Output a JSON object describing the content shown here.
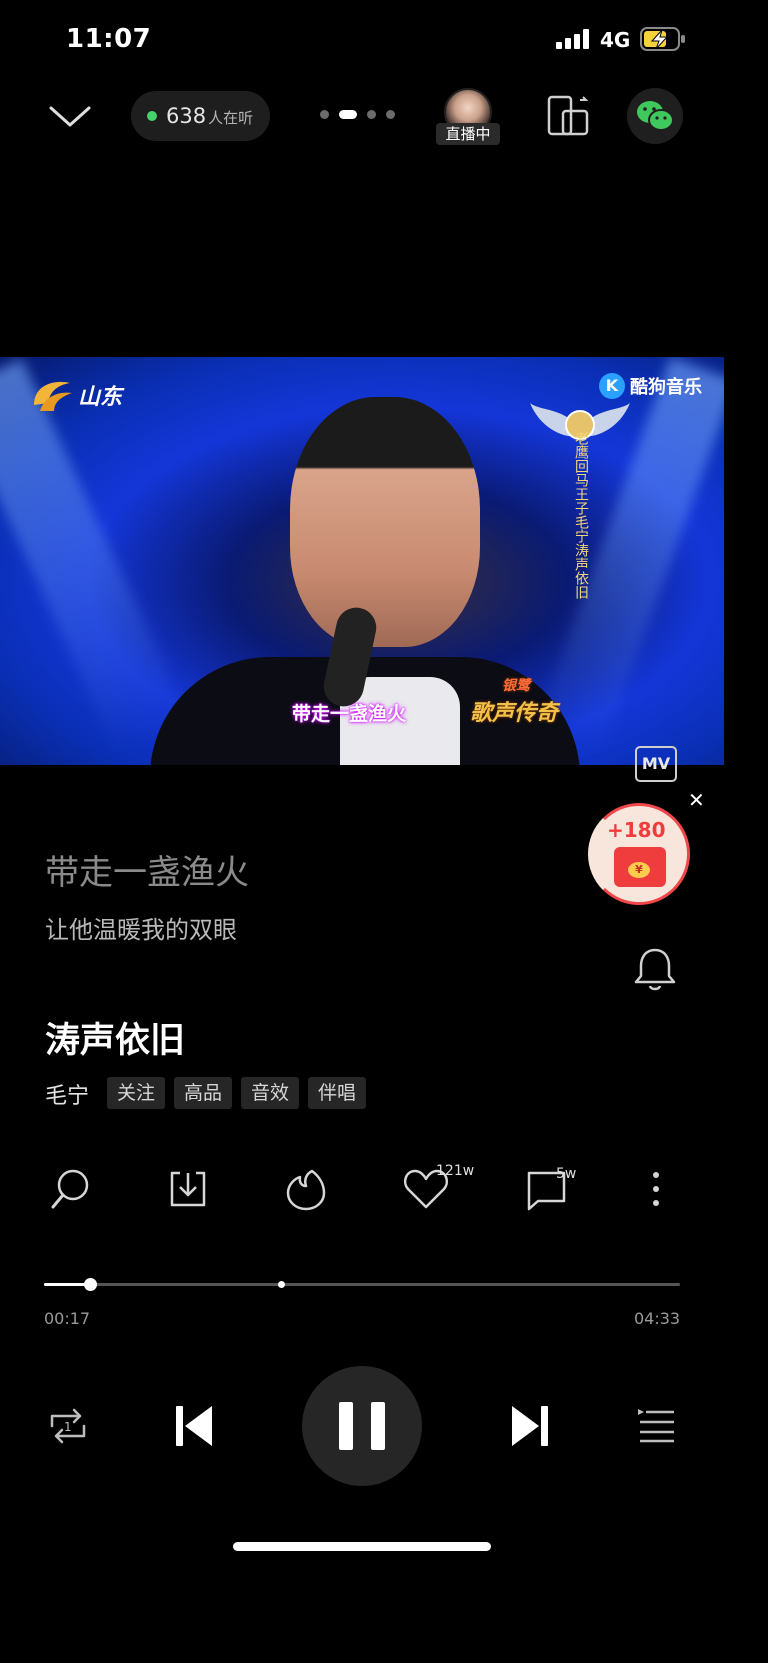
{
  "status_bar": {
    "time": "11:07",
    "network": "4G"
  },
  "header": {
    "listening_count": "638",
    "listening_suffix": "人在听",
    "live_badge": "直播中",
    "page_dots": 4,
    "active_dot": 2
  },
  "video": {
    "logo_left": "山东",
    "logo_right": "酷狗音乐",
    "logo_right_icon": "K",
    "subtitle": "带走一盏渔火",
    "show_logo": "歌声传奇",
    "show_logo_top": "银鹭",
    "vertical_text": "老鹰回马王子毛宁涛声依旧",
    "mv_label": "MV"
  },
  "red_packet": {
    "amount": "+180",
    "coin": "¥"
  },
  "lyrics": {
    "current": "带走一盏渔火",
    "next": "让他温暖我的双眼"
  },
  "song": {
    "title": "涛声依旧",
    "artist": "毛宁",
    "tags": [
      "关注",
      "高品",
      "音效",
      "伴唱"
    ]
  },
  "actions": {
    "like_count": "121w",
    "comment_count": "5w"
  },
  "progress": {
    "current_time": "00:17",
    "total_time": "04:33",
    "fraction": 0.065
  },
  "colors": {
    "accent_green": "#47d36b",
    "red": "#ef3d3d",
    "background": "#000000"
  }
}
